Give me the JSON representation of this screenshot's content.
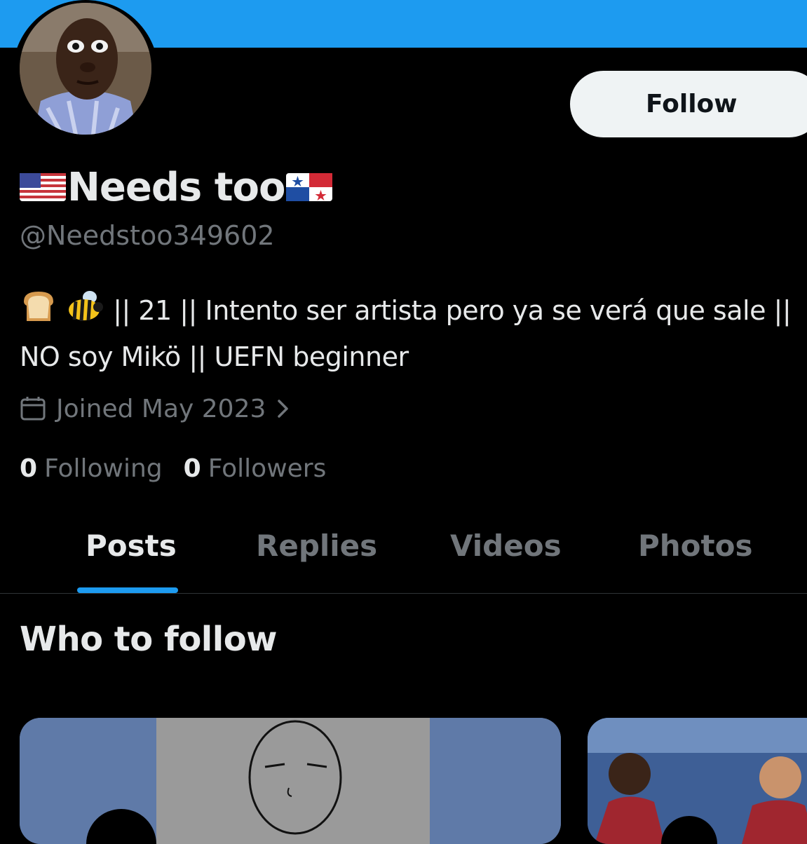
{
  "profile": {
    "display_name": "Needs too",
    "handle": "@Needstoo349602",
    "bio_line1": "|| 21 || Intento ser artista pero ya se verá que sale ||",
    "bio_line2": "NO soy Mikö || UEFN beginner",
    "joined": "Joined May 2023",
    "following_count": "0",
    "following_label": "Following",
    "followers_count": "0",
    "followers_label": "Followers"
  },
  "actions": {
    "follow_label": "Follow"
  },
  "tabs": [
    {
      "label": "Posts",
      "active": true
    },
    {
      "label": "Replies",
      "active": false
    },
    {
      "label": "Videos",
      "active": false
    },
    {
      "label": "Photos",
      "active": false
    }
  ],
  "suggestions": {
    "title": "Who to follow"
  },
  "icons": {
    "flag_left": "us-flag-icon",
    "flag_right": "panama-flag-icon",
    "bio_emoji_1": "bread-icon",
    "bio_emoji_2": "bee-icon",
    "joined_icon": "calendar-icon",
    "joined_chevron": "chevron-right-icon"
  },
  "colors": {
    "accent": "#1d9bf0",
    "background": "#000000",
    "primary_text": "#e7e9ea",
    "secondary_text": "#71767b",
    "follow_button_bg": "#eff3f4"
  }
}
